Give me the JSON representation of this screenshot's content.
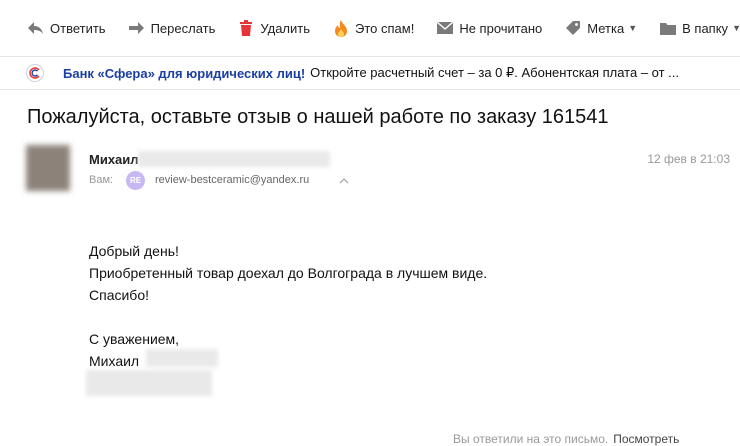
{
  "toolbar": {
    "reply": "Ответить",
    "forward": "Переслать",
    "delete": "Удалить",
    "spam": "Это спам!",
    "unread": "Не прочитано",
    "label": "Метка",
    "folder": "В папку"
  },
  "ad": {
    "title": "Банк «Сфера» для юридических лиц!",
    "text": "Откройте расчетный счет – за 0 ₽. Абонентская плата – от ..."
  },
  "email": {
    "subject": "Пожалуйста, оставьте отзыв о нашей работе по заказу 161541",
    "sender_name": "Михаил",
    "date": "12 фев в 21:03",
    "to_label": "Вам:",
    "recipient_initials": "RE",
    "recipient_email": "review-bestceramic@yandex.ru",
    "body": {
      "line1": "Добрый день!",
      "line2": "Приобретенный товар доехал до Волгограда  в лучшем виде.",
      "line3": "Спасибо!",
      "line4": "С уважением,",
      "line5": "Михаил"
    }
  },
  "footer": {
    "text": "Вы ответили на это письмо.",
    "link": "Посмотреть"
  },
  "colors": {
    "spam_icon": "#f38a1e",
    "delete_icon": "#e5343a",
    "ad_title": "#1b3fa6",
    "recipient_badge": "#c8b8f2"
  }
}
